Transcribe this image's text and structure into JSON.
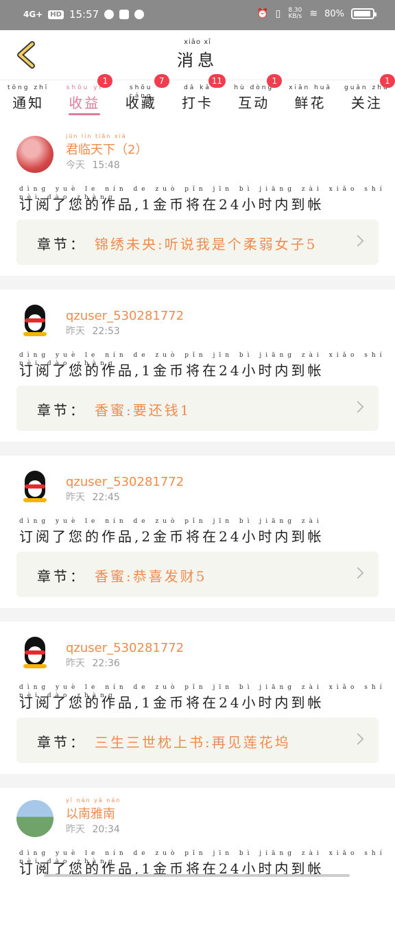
{
  "status": {
    "network": "4G+",
    "hd": "HD",
    "time": "15:57",
    "speed": "8.30 KB/s",
    "battery": "80%"
  },
  "header": {
    "title_pinyin": "xiāo  xī",
    "title": "消息"
  },
  "tabs": [
    {
      "pinyin": "tōng zhī",
      "label": "通知",
      "badge": "",
      "active": false
    },
    {
      "pinyin": "shōu yì",
      "label": "收益",
      "badge": "1",
      "active": true
    },
    {
      "pinyin": "shōu cáng",
      "label": "收藏",
      "badge": "7",
      "active": false
    },
    {
      "pinyin": "dǎ kǎ",
      "label": "打卡",
      "badge": "11",
      "active": false
    },
    {
      "pinyin": "hù dòng",
      "label": "互动",
      "badge": "1",
      "active": false
    },
    {
      "pinyin": "xiān huā",
      "label": "鲜花",
      "badge": "",
      "active": false
    },
    {
      "pinyin": "guān zhù",
      "label": "关注",
      "badge": "1",
      "active": false
    }
  ],
  "messages": [
    {
      "avatar": "red-avatar",
      "user_pinyin": "jūn lín tiān xià",
      "user": "君临天下（2）",
      "day": "今天",
      "clock": "15:48",
      "msg_pinyin": "dìng yuè le nín de zuò pǐn  jīn bì jiāng zài  xiǎo shí nèi dào zhàng",
      "msg": "订阅了您的作品,1金币将在24小时内到帐",
      "chapter_label": "章节：",
      "chapter": "锦绣未央:听说我是个柔弱女子5"
    },
    {
      "avatar": "qq-penguin",
      "user_pinyin": "",
      "user": "qzuser_530281772",
      "day": "昨天",
      "clock": "22:53",
      "msg_pinyin": "dìng yuè le nín de zuò pǐn  jīn bì jiāng zài  xiǎo shí nèi dào zhàng",
      "msg": "订阅了您的作品,1金币将在24小时内到帐",
      "chapter_label": "章节：",
      "chapter": "香蜜:要还钱1"
    },
    {
      "avatar": "qq-penguin",
      "user_pinyin": "",
      "user": "qzuser_530281772",
      "day": "昨天",
      "clock": "22:45",
      "msg_pinyin": "dìng yuè le nín de zuò pǐn  jīn bì jiāng zài",
      "msg": "订阅了您的作品,2金币将在24小时内到帐",
      "chapter_label": "章节：",
      "chapter": "香蜜:恭喜发财5"
    },
    {
      "avatar": "qq-penguin",
      "user_pinyin": "",
      "user": "qzuser_530281772",
      "day": "昨天",
      "clock": "22:36",
      "msg_pinyin": "dìng yuè le nín de zuò pǐn  jīn bì jiāng zài  xiǎo shí nèi dào zhàng",
      "msg": "订阅了您的作品,1金币将在24小时内到帐",
      "chapter_label": "章节：",
      "chapter": "三生三世枕上书:再见莲花坞"
    },
    {
      "avatar": "scene-avatar",
      "user_pinyin": "yǐ nán yǎ nán",
      "user": "以南雅南",
      "day": "昨天",
      "clock": "20:34",
      "msg_pinyin": "dìng yuè le nín de zuò pǐn  jīn bì jiāng zài  xiǎo shí nèi dào zhàng",
      "msg": "订阅了您的作品,1金币将在24小时内到帐",
      "chapter_label": "",
      "chapter": ""
    }
  ]
}
